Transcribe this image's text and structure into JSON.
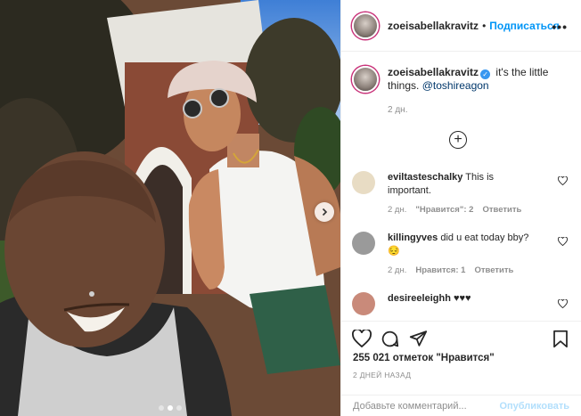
{
  "post": {
    "username": "zoeisabellakravitz",
    "follow_label": "Подписаться",
    "more_label": "•••",
    "caption_text": " it's the little things. ",
    "caption_mention": "@toshireagon",
    "caption_time": "2 дн.",
    "load_more_label": "+"
  },
  "comments": [
    {
      "user": "eviltasteschalky",
      "text": "This is important.",
      "time": "2 дн.",
      "likes": "\"Нравится\": 2",
      "reply": "Ответить",
      "avatar_color": "#e8dcc4"
    },
    {
      "user": "killingyves",
      "text": "did u eat today bby? 😔",
      "time": "2 дн.",
      "likes": "Нравится: 1",
      "reply": "Ответить",
      "avatar_color": "#9a9a9a"
    },
    {
      "user": "desireeleighh",
      "text": "♥♥♥",
      "time": "",
      "likes": "",
      "reply": "",
      "avatar_color": "#c98a7a"
    }
  ],
  "stats": {
    "likes_label": "255 021 отметок \"Нравится\"",
    "date_label": "2 ДНЕЙ НАЗАД"
  },
  "add_comment": {
    "placeholder": "Добавьте комментарий...",
    "publish_label": "Опубликовать"
  },
  "icons": {
    "like": "heart-icon",
    "comment": "comment-icon",
    "share": "paper-plane-icon",
    "save": "bookmark-icon",
    "verified": "verified-badge-icon"
  },
  "colors": {
    "accent": "#0095f6",
    "publish_disabled": "#b2dffc",
    "muted": "#8e8e8e"
  }
}
